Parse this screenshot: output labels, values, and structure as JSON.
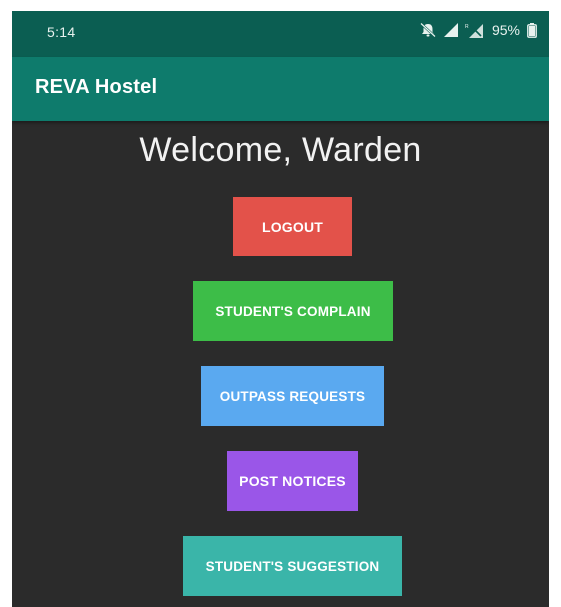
{
  "status_bar": {
    "time": "5:14",
    "battery": "95%",
    "icons": [
      "notifications-off-icon",
      "signal-icon",
      "no-signal-icon",
      "battery-icon"
    ]
  },
  "app_bar": {
    "title": "REVA Hostel",
    "color": "#0e7b6c"
  },
  "main": {
    "welcome": "Welcome, Warden",
    "buttons": [
      {
        "label": "LOGOUT",
        "color": "#e3524a"
      },
      {
        "label": "STUDENT'S COMPLAIN",
        "color": "#3dbd48"
      },
      {
        "label": "OUTPASS REQUESTS",
        "color": "#5aa9f0"
      },
      {
        "label": "POST NOTICES",
        "color": "#9a56e8"
      },
      {
        "label": "STUDENT'S SUGGESTION",
        "color": "#3ab5a9"
      }
    ]
  }
}
